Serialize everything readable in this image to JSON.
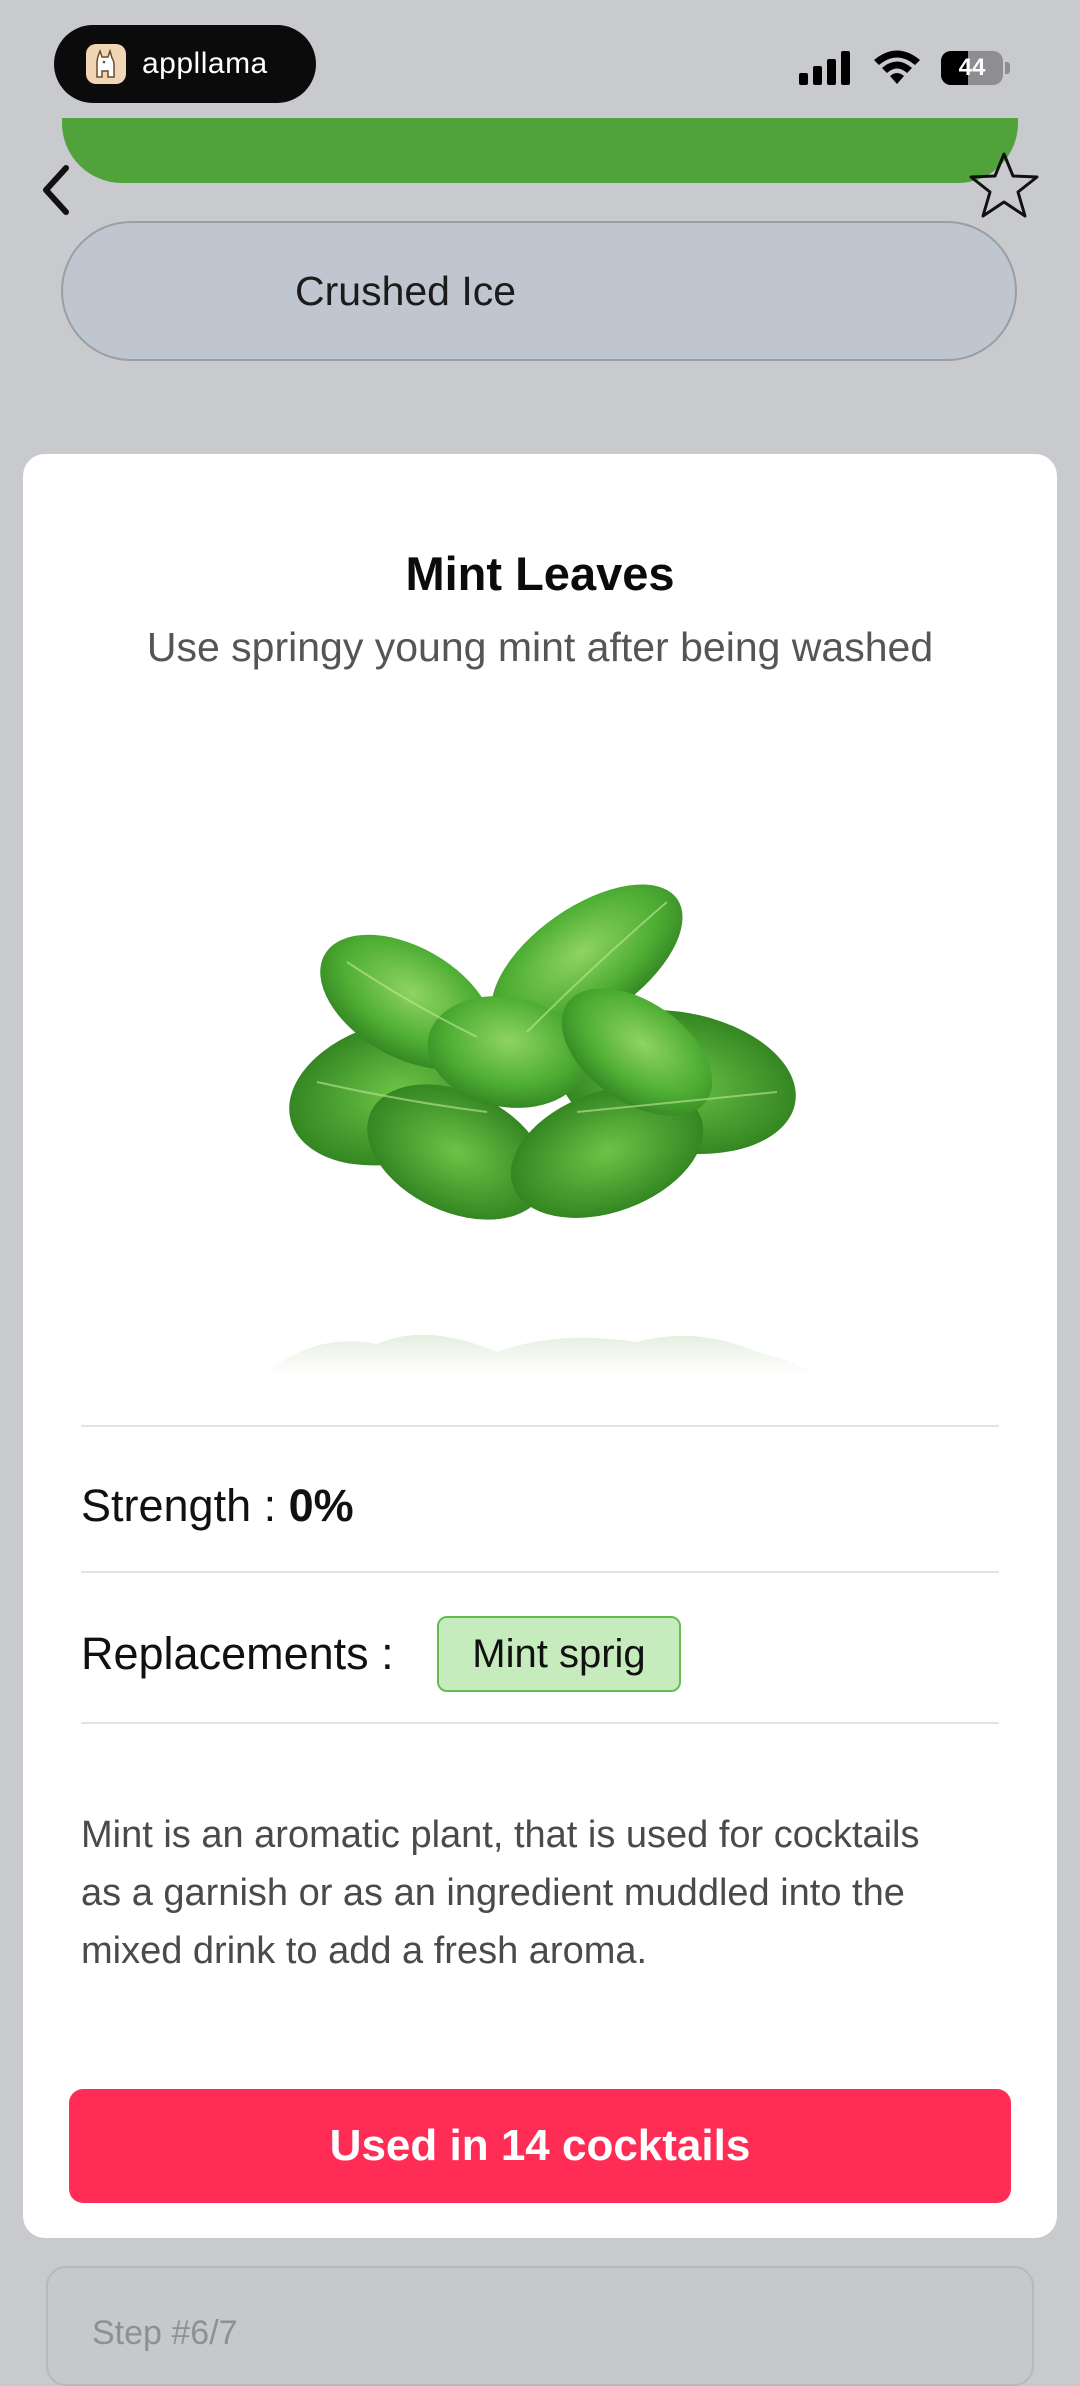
{
  "status_bar": {
    "brand_name": "appllama",
    "battery_level": "44",
    "icons": [
      "cellular-signal-icon",
      "wifi-icon",
      "battery-icon"
    ]
  },
  "background_list": {
    "selected_item": "Mint Leaves",
    "items": [
      {
        "label": "Crushed Ice"
      }
    ],
    "step_label": "Step #6/7"
  },
  "modal": {
    "title": "Mint Leaves",
    "subtitle": "Use springy young mint after being washed",
    "image_icon": "mint-leaves-image",
    "strength_label": "Strength :",
    "strength_value": "0%",
    "replacements_label": "Replacements :",
    "replacements": [
      "Mint sprig"
    ],
    "description": "Mint is an aromatic plant, that is used for cocktails as a garnish or as an ingredient muddled into the mixed drink to add a fresh aroma.",
    "cta_label": "Used in 14 cocktails"
  },
  "colors": {
    "accent": "#ff2d55",
    "selected_green": "#50a23a",
    "chip_bg": "#c6ecbd",
    "chip_border": "#62be4f"
  }
}
